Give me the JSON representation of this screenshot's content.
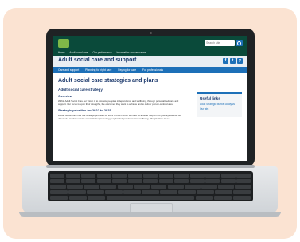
{
  "header": {
    "search_placeholder": "Search site",
    "breadcrumbs": [
      "Home",
      "Adult social care",
      "Our performance",
      "Information and resources"
    ]
  },
  "section": {
    "title": "Adult social care and support"
  },
  "social": [
    "f",
    "t",
    "y"
  ],
  "nav": {
    "items": [
      "Care and support",
      "Planning for right care",
      "Paying for care",
      "For professionals"
    ]
  },
  "page": {
    "title": "Adult social care strategies and plans",
    "strategy_heading": "Adult social care strategy",
    "overview_heading": "Overview",
    "overview_text": "Within Adult Social Care our vision is to promote people's independence and wellbeing, through personalised care and support. Our focus is upon their strengths, the outcomes they want to achieve and to deliver person-centred care.",
    "priorities_heading": "Strategic priorities for 2022 to 2025",
    "priorities_text": "Leeds Social Care has five strategic priorities for 2022 to 2025 which will take us another step on our journey towards our vision of a modern service committed to promoting people's independence and wellbeing. The priorities are to:"
  },
  "useful_links": {
    "title": "Useful links",
    "items": [
      "Adult Strategic Market Analysis",
      "Our aim"
    ]
  },
  "colors": {
    "header_green": "#0a4a3a",
    "brand_blue": "#1d70b8",
    "heading_navy": "#1d3a6d",
    "background_peach": "#fbe3d2"
  }
}
